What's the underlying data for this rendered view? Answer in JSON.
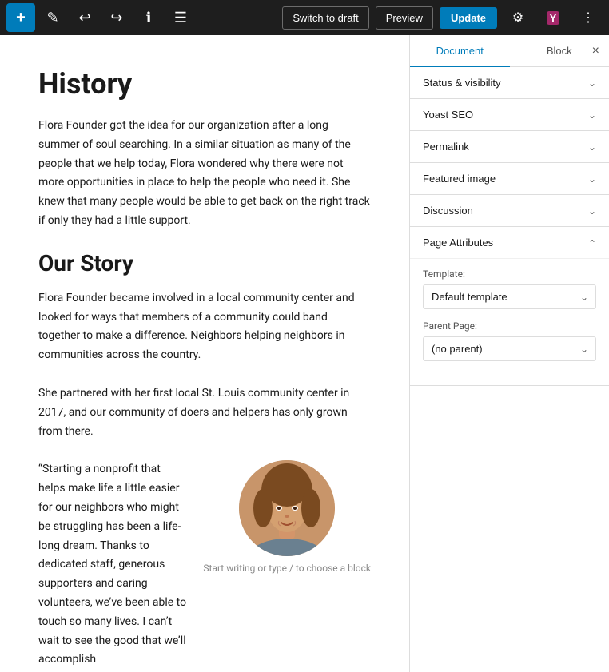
{
  "toolbar": {
    "add_icon": "+",
    "pencil_icon": "✎",
    "undo_icon": "↩",
    "redo_icon": "↪",
    "info_icon": "ℹ",
    "list_icon": "≡",
    "switch_draft_label": "Switch to draft",
    "preview_label": "Preview",
    "update_label": "Update",
    "settings_icon": "⚙",
    "yoast_icon": "Y",
    "more_icon": "⋮"
  },
  "editor": {
    "heading": "History",
    "paragraph1": "Flora Founder got the idea for our organization after a long summer of soul searching. In a similar situation as many of the people that we help today, Flora wondered why there were not more opportunities in place to help the people who need it. She knew that many people would be able to get back on the right track if only they had a little support.",
    "heading2": "Our Story",
    "paragraph2": "Flora Founder became involved in a local community center and looked for ways that members of a community could band together to make a difference. Neighbors helping neighbors in communities across the country.",
    "paragraph3": "She partnered with her first local St. Louis community center in 2017, and our community of doers and helpers has only grown from there.",
    "quote": "“Starting a nonprofit that helps make life a little easier for our neighbors who might be struggling has been a life-long dream. Thanks to dedicated staff, generous supporters and caring volunteers, we’ve been able to touch so many lives. I can’t wait to see the good that we’ll accomplish",
    "start_writing": "Start writing or type / to choose a block"
  },
  "sidebar": {
    "tab_document": "Document",
    "tab_block": "Block",
    "close_icon": "×",
    "accordion_items": [
      {
        "label": "Status & visibility",
        "expanded": false
      },
      {
        "label": "Yoast SEO",
        "expanded": false
      },
      {
        "label": "Permalink",
        "expanded": false
      },
      {
        "label": "Featured image",
        "expanded": false
      },
      {
        "label": "Discussion",
        "expanded": false
      },
      {
        "label": "Page Attributes",
        "expanded": true
      }
    ],
    "page_attributes": {
      "template_label": "Template:",
      "template_value": "Default template",
      "parent_label": "Parent Page:",
      "parent_value": "(no parent)"
    }
  }
}
